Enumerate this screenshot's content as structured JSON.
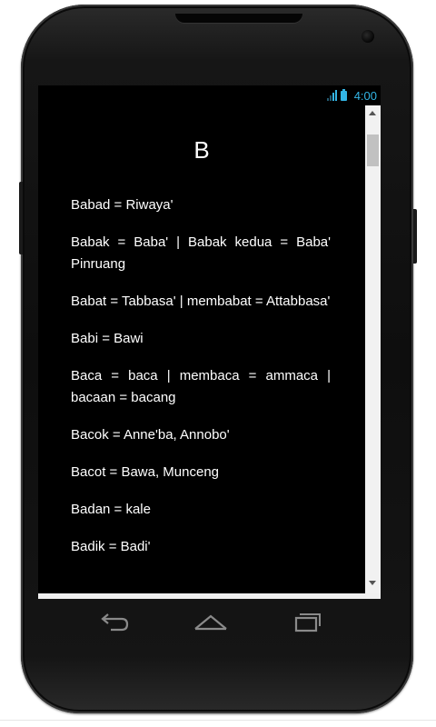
{
  "status_bar": {
    "time": "4:00",
    "accent_color": "#33b5e5",
    "signal_icon": "signal-icon",
    "battery_icon": "battery-icon"
  },
  "dictionary": {
    "title": "B",
    "entries": [
      "Babad = Riwaya'",
      "Babak = Baba' | Babak kedua = Baba' Pinruang",
      "Babat = Tabbasa' | membabat = Attabbasa'",
      "Babi = Bawi",
      "Baca = baca | membaca = ammaca | bacaan = bacang",
      "Bacok = Anne'ba, Annobo'",
      "Bacot = Bawa, Munceng",
      "Badan = kale",
      "Badik = Badi'"
    ]
  },
  "navigation": {
    "back_icon": "back-icon",
    "home_icon": "home-icon",
    "recent_icon": "recent-apps-icon"
  }
}
